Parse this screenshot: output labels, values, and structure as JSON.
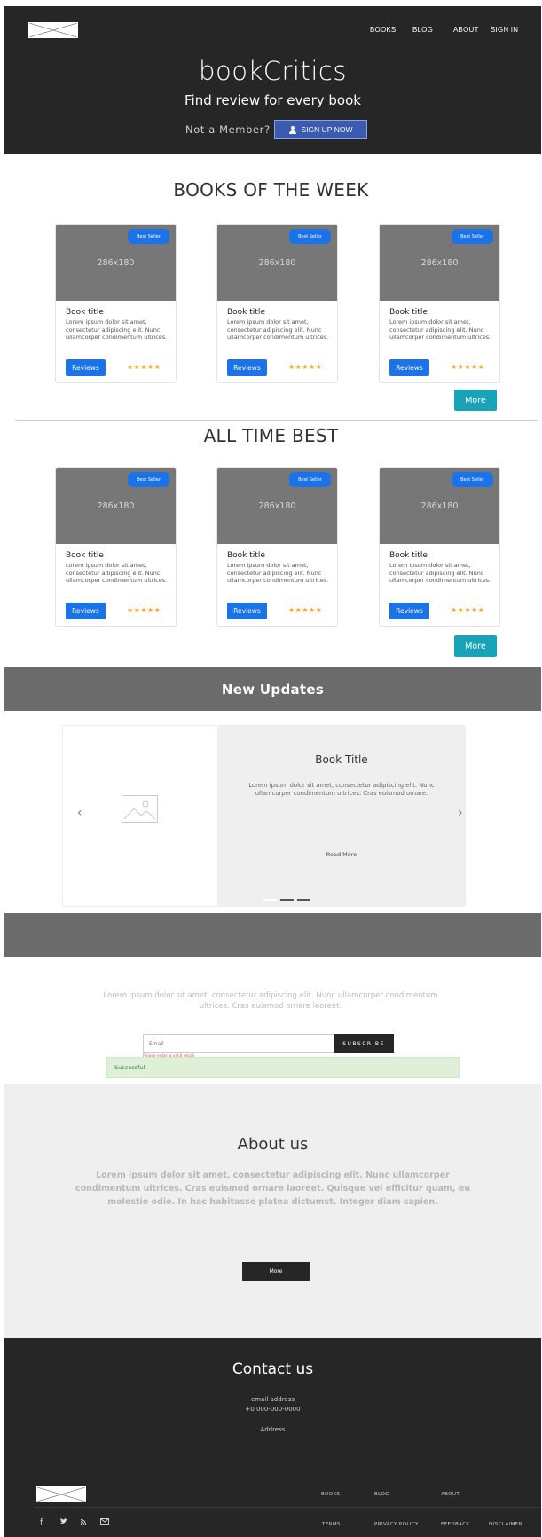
{
  "header": {
    "nav": [
      "BOOKS",
      "BLOG",
      "ABOUT",
      "SIGN IN"
    ],
    "brand": "bookCritics",
    "tagline": "Find review for every book",
    "member_prompt": "Not a Member?",
    "signup_label": "SIGN UP NOW"
  },
  "books_of_week": {
    "title": "BOOKS OF THE WEEK",
    "cards": [
      {
        "placeholder": "286x180",
        "badge": "Best Seller",
        "title": "Book title",
        "text": "Lorem ipsum dolor sit amet, consectetur adipiscing elit. Nunc ullamcorper condimentum ultrices.",
        "button": "Reviews",
        "stars": "★★★★★"
      },
      {
        "placeholder": "286x180",
        "badge": "Best Seller",
        "title": "Book title",
        "text": "Lorem ipsum dolor sit amet, consectetur adipiscing elit. Nunc ullamcorper condimentum ultrices.",
        "button": "Reviews",
        "stars": "★★★★★"
      },
      {
        "placeholder": "286x180",
        "badge": "Best Seller",
        "title": "Book title",
        "text": "Lorem ipsum dolor sit amet, consectetur adipiscing elit. Nunc ullamcorper condimentum ultrices.",
        "button": "Reviews",
        "stars": "★★★★★"
      }
    ],
    "more_label": "More"
  },
  "all_time_best": {
    "title": "ALL TIME BEST",
    "cards": [
      {
        "placeholder": "286x180",
        "badge": "Best Seller",
        "title": "Book title",
        "text": "Lorem ipsum dolor sit amet, consectetur adipiscing elit. Nunc ullamcorper condimentum ultrices.",
        "button": "Reviews",
        "stars": "★★★★★"
      },
      {
        "placeholder": "286x180",
        "badge": "Best Seller",
        "title": "Book title",
        "text": "Lorem ipsum dolor sit amet, consectetur adipiscing elit. Nunc ullamcorper condimentum ultrices.",
        "button": "Reviews",
        "stars": "★★★★★"
      },
      {
        "placeholder": "286x180",
        "badge": "Best Seller",
        "title": "Book title",
        "text": "Lorem ipsum dolor sit amet, consectetur adipiscing elit. Nunc ullamcorper condimentum ultrices.",
        "button": "Reviews",
        "stars": "★★★★★"
      }
    ],
    "more_label": "More"
  },
  "updates": {
    "title": "New Updates",
    "slide_title": "Book Title",
    "slide_text": "Lorem ipsum dolor sit amet, consectetur adipiscing elit. Nunc ullamcorper condimentum ultrices. Cras euismod ornare.",
    "read_more": "Read More",
    "prev": "‹",
    "next": "›"
  },
  "subscribe": {
    "text": "Lorem ipsum dolor sit amet, consectetur adipiscing elit. Nunc ullamcorper condimentum ultrices. Cras euismod ornare laoreet.",
    "email_placeholder": "Email",
    "button": "SUBSCRIBE",
    "error": "Please enter a valid email",
    "success": "Successful"
  },
  "about": {
    "title": "About us",
    "text": "Lorem ipsum dolor sit amet, consectetur adipiscing elit. Nunc ullamcorper condimentum ultrices. Cras euismod ornare laoreet. Quisque vel efficitur quam, eu molestie odio. In hac habitasse platea dictumst. Integer diam sapien.",
    "button": "More"
  },
  "footer": {
    "title": "Contact us",
    "email": "email address",
    "phone": "+0 000-000-0000",
    "address": "Address",
    "nav": [
      "BOOKS",
      "BLOG",
      "ABOUT"
    ],
    "legal": [
      "TERMS",
      "PRIVACY POLICY",
      "FEEDBACK",
      "DISCLAIMER"
    ],
    "social_icons": [
      "facebook-icon",
      "twitter-icon",
      "rss-icon",
      "mail-icon"
    ]
  }
}
